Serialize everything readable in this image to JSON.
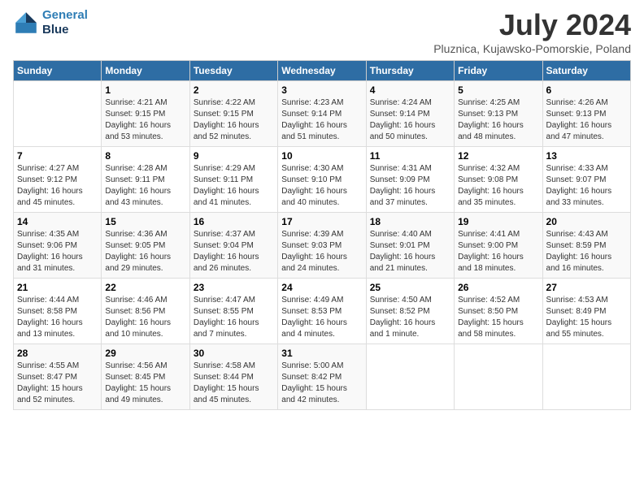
{
  "header": {
    "logo_line1": "General",
    "logo_line2": "Blue",
    "month_title": "July 2024",
    "subtitle": "Pluznica, Kujawsko-Pomorskie, Poland"
  },
  "days_of_week": [
    "Sunday",
    "Monday",
    "Tuesday",
    "Wednesday",
    "Thursday",
    "Friday",
    "Saturday"
  ],
  "weeks": [
    [
      {
        "day": "",
        "content": ""
      },
      {
        "day": "1",
        "content": "Sunrise: 4:21 AM\nSunset: 9:15 PM\nDaylight: 16 hours\nand 53 minutes."
      },
      {
        "day": "2",
        "content": "Sunrise: 4:22 AM\nSunset: 9:15 PM\nDaylight: 16 hours\nand 52 minutes."
      },
      {
        "day": "3",
        "content": "Sunrise: 4:23 AM\nSunset: 9:14 PM\nDaylight: 16 hours\nand 51 minutes."
      },
      {
        "day": "4",
        "content": "Sunrise: 4:24 AM\nSunset: 9:14 PM\nDaylight: 16 hours\nand 50 minutes."
      },
      {
        "day": "5",
        "content": "Sunrise: 4:25 AM\nSunset: 9:13 PM\nDaylight: 16 hours\nand 48 minutes."
      },
      {
        "day": "6",
        "content": "Sunrise: 4:26 AM\nSunset: 9:13 PM\nDaylight: 16 hours\nand 47 minutes."
      }
    ],
    [
      {
        "day": "7",
        "content": "Sunrise: 4:27 AM\nSunset: 9:12 PM\nDaylight: 16 hours\nand 45 minutes."
      },
      {
        "day": "8",
        "content": "Sunrise: 4:28 AM\nSunset: 9:11 PM\nDaylight: 16 hours\nand 43 minutes."
      },
      {
        "day": "9",
        "content": "Sunrise: 4:29 AM\nSunset: 9:11 PM\nDaylight: 16 hours\nand 41 minutes."
      },
      {
        "day": "10",
        "content": "Sunrise: 4:30 AM\nSunset: 9:10 PM\nDaylight: 16 hours\nand 40 minutes."
      },
      {
        "day": "11",
        "content": "Sunrise: 4:31 AM\nSunset: 9:09 PM\nDaylight: 16 hours\nand 37 minutes."
      },
      {
        "day": "12",
        "content": "Sunrise: 4:32 AM\nSunset: 9:08 PM\nDaylight: 16 hours\nand 35 minutes."
      },
      {
        "day": "13",
        "content": "Sunrise: 4:33 AM\nSunset: 9:07 PM\nDaylight: 16 hours\nand 33 minutes."
      }
    ],
    [
      {
        "day": "14",
        "content": "Sunrise: 4:35 AM\nSunset: 9:06 PM\nDaylight: 16 hours\nand 31 minutes."
      },
      {
        "day": "15",
        "content": "Sunrise: 4:36 AM\nSunset: 9:05 PM\nDaylight: 16 hours\nand 29 minutes."
      },
      {
        "day": "16",
        "content": "Sunrise: 4:37 AM\nSunset: 9:04 PM\nDaylight: 16 hours\nand 26 minutes."
      },
      {
        "day": "17",
        "content": "Sunrise: 4:39 AM\nSunset: 9:03 PM\nDaylight: 16 hours\nand 24 minutes."
      },
      {
        "day": "18",
        "content": "Sunrise: 4:40 AM\nSunset: 9:01 PM\nDaylight: 16 hours\nand 21 minutes."
      },
      {
        "day": "19",
        "content": "Sunrise: 4:41 AM\nSunset: 9:00 PM\nDaylight: 16 hours\nand 18 minutes."
      },
      {
        "day": "20",
        "content": "Sunrise: 4:43 AM\nSunset: 8:59 PM\nDaylight: 16 hours\nand 16 minutes."
      }
    ],
    [
      {
        "day": "21",
        "content": "Sunrise: 4:44 AM\nSunset: 8:58 PM\nDaylight: 16 hours\nand 13 minutes."
      },
      {
        "day": "22",
        "content": "Sunrise: 4:46 AM\nSunset: 8:56 PM\nDaylight: 16 hours\nand 10 minutes."
      },
      {
        "day": "23",
        "content": "Sunrise: 4:47 AM\nSunset: 8:55 PM\nDaylight: 16 hours\nand 7 minutes."
      },
      {
        "day": "24",
        "content": "Sunrise: 4:49 AM\nSunset: 8:53 PM\nDaylight: 16 hours\nand 4 minutes."
      },
      {
        "day": "25",
        "content": "Sunrise: 4:50 AM\nSunset: 8:52 PM\nDaylight: 16 hours\nand 1 minute."
      },
      {
        "day": "26",
        "content": "Sunrise: 4:52 AM\nSunset: 8:50 PM\nDaylight: 15 hours\nand 58 minutes."
      },
      {
        "day": "27",
        "content": "Sunrise: 4:53 AM\nSunset: 8:49 PM\nDaylight: 15 hours\nand 55 minutes."
      }
    ],
    [
      {
        "day": "28",
        "content": "Sunrise: 4:55 AM\nSunset: 8:47 PM\nDaylight: 15 hours\nand 52 minutes."
      },
      {
        "day": "29",
        "content": "Sunrise: 4:56 AM\nSunset: 8:45 PM\nDaylight: 15 hours\nand 49 minutes."
      },
      {
        "day": "30",
        "content": "Sunrise: 4:58 AM\nSunset: 8:44 PM\nDaylight: 15 hours\nand 45 minutes."
      },
      {
        "day": "31",
        "content": "Sunrise: 5:00 AM\nSunset: 8:42 PM\nDaylight: 15 hours\nand 42 minutes."
      },
      {
        "day": "",
        "content": ""
      },
      {
        "day": "",
        "content": ""
      },
      {
        "day": "",
        "content": ""
      }
    ]
  ]
}
